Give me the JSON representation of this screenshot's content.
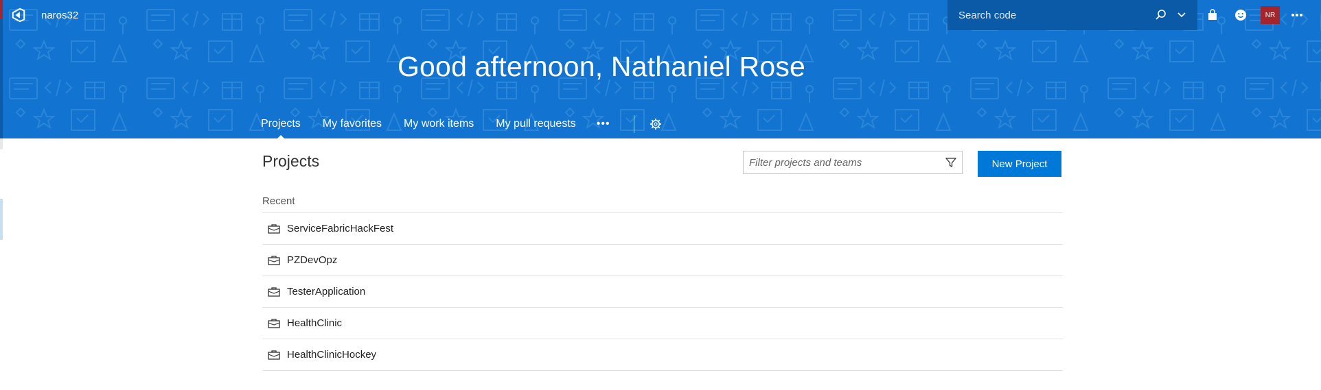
{
  "header": {
    "org_name": "naros32",
    "search_placeholder": "Search code",
    "avatar_initials": "NR",
    "greeting": "Good afternoon, Nathaniel Rose",
    "icons": [
      "vsts-logo-icon",
      "search-icon",
      "chevron-down-icon",
      "marketplace-bag-icon",
      "smiley-feedback-icon",
      "more-horizontal-icon"
    ]
  },
  "hub_nav": {
    "tabs": [
      {
        "label": "Projects",
        "active": true
      },
      {
        "label": "My favorites",
        "active": false
      },
      {
        "label": "My work items",
        "active": false
      },
      {
        "label": "My pull requests",
        "active": false
      }
    ],
    "more_label": "•••"
  },
  "main": {
    "title": "Projects",
    "filter_placeholder": "Filter projects and teams",
    "new_project_label": "New Project",
    "section_label": "Recent",
    "projects": [
      {
        "name": "ServiceFabricHackFest"
      },
      {
        "name": "PZDevOpz"
      },
      {
        "name": "TesterApplication"
      },
      {
        "name": "HealthClinic"
      },
      {
        "name": "HealthClinicHockey"
      }
    ]
  },
  "colors": {
    "banner": "#1274d0",
    "search_bg": "#0a5aa8",
    "accent_button": "#0078d7",
    "avatar_bg": "#a4262c"
  }
}
